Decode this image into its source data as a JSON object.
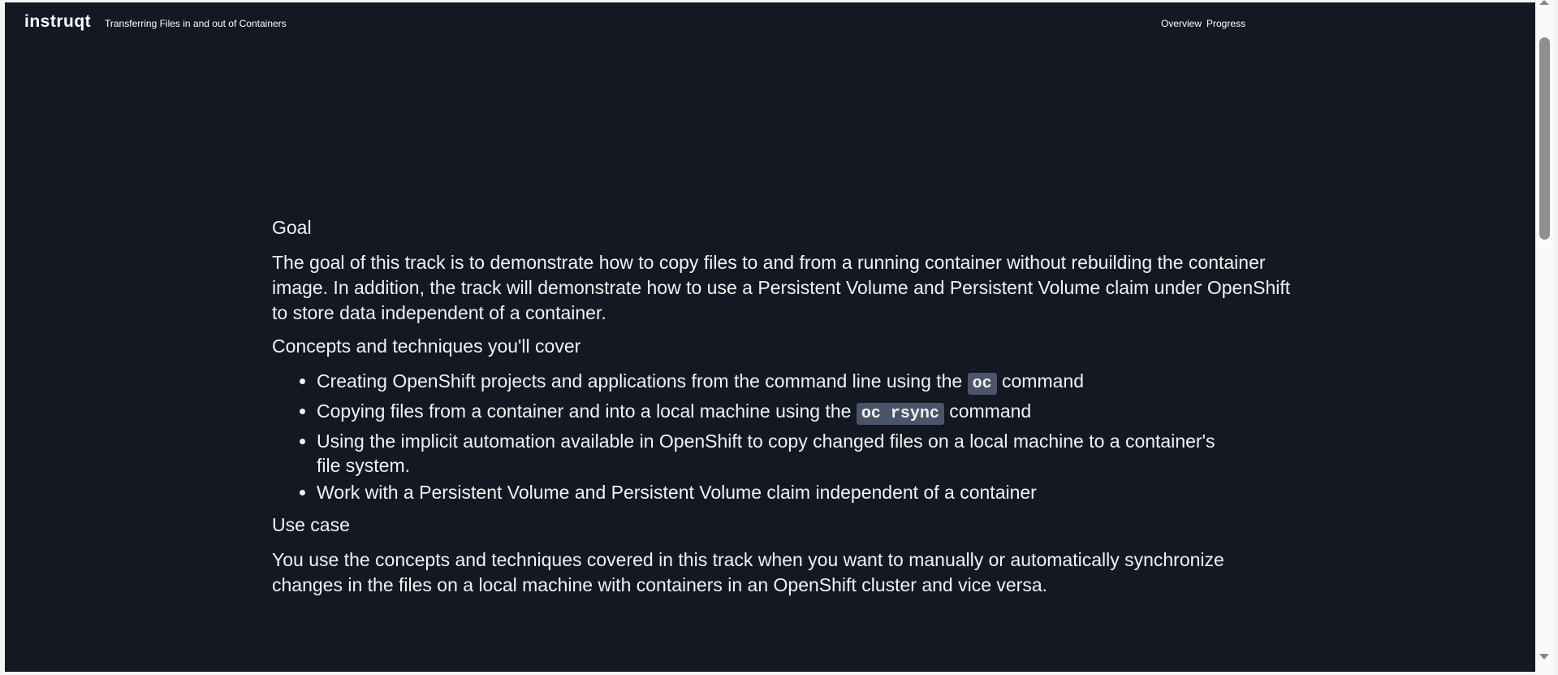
{
  "header": {
    "logo": "instruqt",
    "title": "Transferring Files in and out of Containers",
    "nav": [
      "Overview",
      "Progress"
    ]
  },
  "content": {
    "goal_heading": "Goal",
    "goal_text": "The goal of this track is to demonstrate how to copy files to and from a running container without rebuilding the container image. In addition, the track will demonstrate how to use a Persistent Volume and Persistent Volume claim under OpenShift to store data independent of a container.",
    "concepts_heading": "Concepts and techniques you'll cover",
    "bullets": [
      {
        "pre": "Creating OpenShift projects and applications from the command line using the ",
        "code": "oc",
        "post": " command"
      },
      {
        "pre": "Copying files from a container and into a local machine using the ",
        "code": "oc rsync",
        "post": " command"
      },
      {
        "pre": "Using the implicit automation available in OpenShift to copy changed files on a local machine to a container's file system."
      },
      {
        "pre": "Work with a Persistent Volume and Persistent Volume claim independent of a container"
      }
    ],
    "usecase_heading": "Use case",
    "usecase_text": "You use the concepts and techniques covered in this track when you want to manually or automatically synchronize changes in the files on a local machine with containers in an OpenShift cluster and vice versa."
  }
}
